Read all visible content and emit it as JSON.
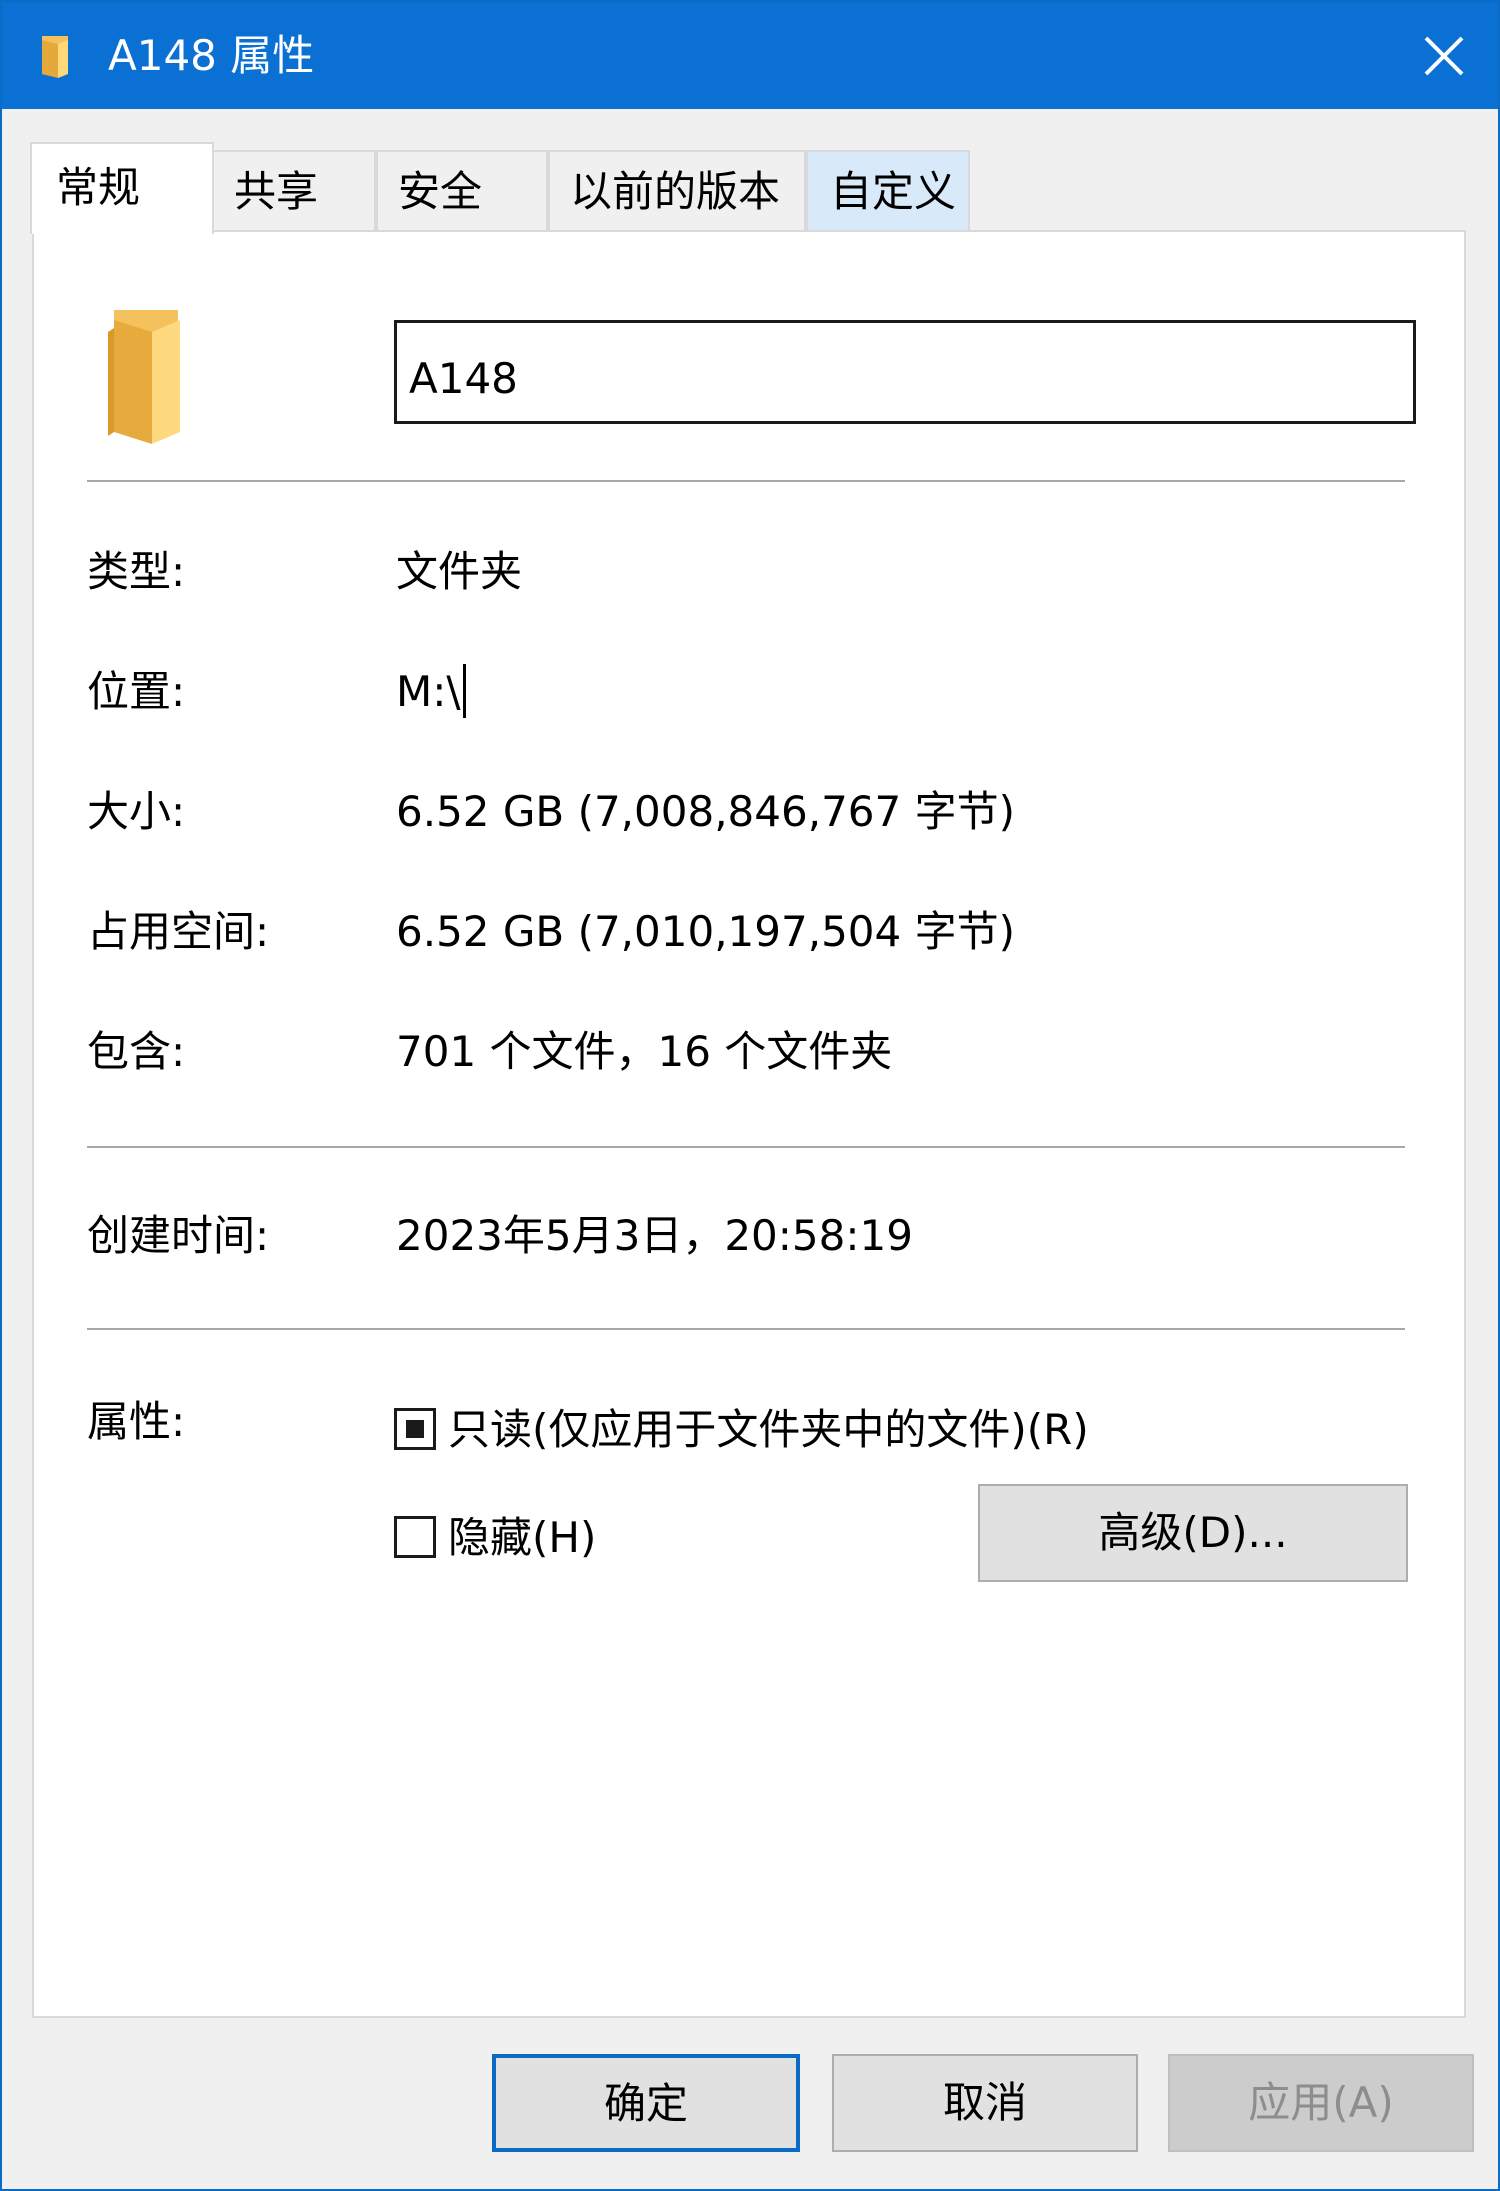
{
  "window": {
    "title": "A148 属性",
    "close": "×"
  },
  "tabs": [
    {
      "label": "常规"
    },
    {
      "label": "共享"
    },
    {
      "label": "安全"
    },
    {
      "label": "以前的版本"
    },
    {
      "label": "自定义"
    }
  ],
  "general": {
    "name": "A148",
    "type_label": "类型:",
    "type_value": "文件夹",
    "location_label": "位置:",
    "location_value": "M:\\",
    "size_label": "大小:",
    "size_value": "6.52 GB (7,008,846,767 字节)",
    "disk_label": "占用空间:",
    "disk_value": "6.52 GB (7,010,197,504 字节)",
    "contains_label": "包含:",
    "contains_value": "701 个文件，16 个文件夹",
    "created_label": "创建时间:",
    "created_value": "2023年5月3日，20:58:19",
    "attributes_label": "属性:",
    "readonly_label": "只读(仅应用于文件夹中的文件)(R)",
    "readonly_state": "indeterminate",
    "hidden_label": "隐藏(H)",
    "hidden_state": "unchecked",
    "advanced_button": "高级(D)..."
  },
  "footer": {
    "ok": "确定",
    "cancel": "取消",
    "apply": "应用(A)"
  },
  "colors": {
    "titlebar": "#0a70d4",
    "folder": "#f4c15d",
    "default_button_border": "#0a6bc6"
  },
  "icons": {
    "title": "folder-icon",
    "main": "folder-icon",
    "close": "close-icon"
  }
}
